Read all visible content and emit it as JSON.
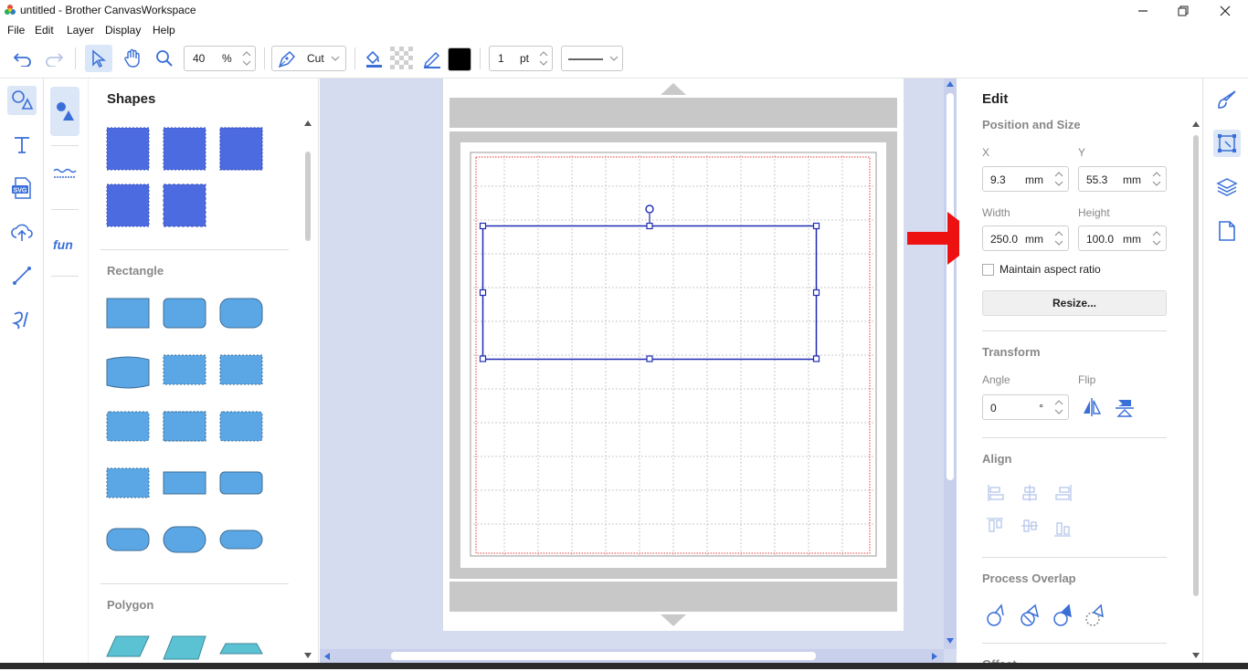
{
  "window": {
    "title": "untitled - Brother CanvasWorkspace"
  },
  "menu": [
    "File",
    "Edit",
    "Layer",
    "Display",
    "Help"
  ],
  "toolbar": {
    "zoom_value": "40",
    "zoom_unit": "%",
    "line_type": "Cut",
    "fill_color": "#000000",
    "stroke_value": "1",
    "stroke_unit": "pt"
  },
  "library": {
    "title": "Shapes",
    "sections": [
      "Rectangle",
      "Polygon"
    ],
    "blue_shape_color": "#4d6be0",
    "light_shape_color": "#5ba7e6"
  },
  "edit_panel": {
    "title": "Edit",
    "position_size": {
      "heading": "Position and Size",
      "x_label": "X",
      "x_value": "9.3",
      "x_unit": "mm",
      "y_label": "Y",
      "y_value": "55.3",
      "y_unit": "mm",
      "width_label": "Width",
      "width_value": "250.0",
      "width_unit": "mm",
      "height_label": "Height",
      "height_value": "100.0",
      "height_unit": "mm",
      "aspect_label": "Maintain aspect ratio",
      "resize_button": "Resize..."
    },
    "transform": {
      "heading": "Transform",
      "angle_label": "Angle",
      "angle_value": "0",
      "angle_unit": "°",
      "flip_label": "Flip"
    },
    "align": {
      "heading": "Align"
    },
    "process_overlap": {
      "heading": "Process Overlap"
    },
    "offset": {
      "heading": "Offset"
    }
  },
  "annotation": {
    "arrow_color": "#ee1111"
  }
}
